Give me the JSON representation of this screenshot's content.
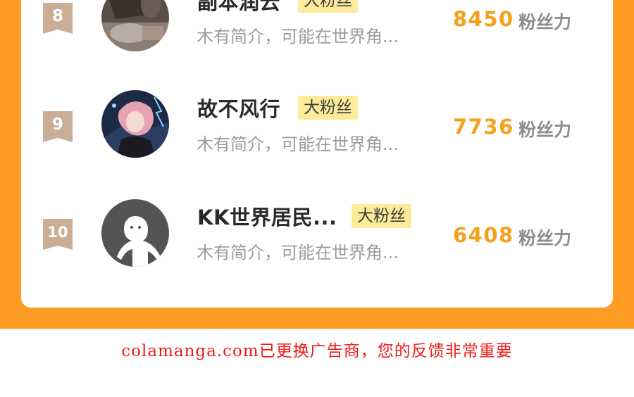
{
  "ranking": {
    "rows": [
      {
        "rank": "8",
        "name": "副本润云",
        "badge": "大粉丝",
        "bio": "木有简介，可能在世界角...",
        "score": "8450",
        "score_label": "粉丝力",
        "avatar": "dark-photo-avatar"
      },
      {
        "rank": "9",
        "name": "故不风行",
        "badge": "大粉丝",
        "bio": "木有简介，可能在世界角...",
        "score": "7736",
        "score_label": "粉丝力",
        "avatar": "anime-character-avatar"
      },
      {
        "rank": "10",
        "name": "KK世界居民...",
        "badge": "大粉丝",
        "bio": "木有简介，可能在世界角...",
        "score": "6408",
        "score_label": "粉丝力",
        "avatar": "default-user-avatar"
      }
    ]
  },
  "footer": {
    "notice": "colamanga.com已更换广告商，您的反馈非常重要"
  },
  "colors": {
    "background_orange": "#ff9c24",
    "score": "#f4a11d",
    "badge": "#fdeb9a",
    "rank_tag": "#c9ad94",
    "notice": "#ef1a1a"
  }
}
